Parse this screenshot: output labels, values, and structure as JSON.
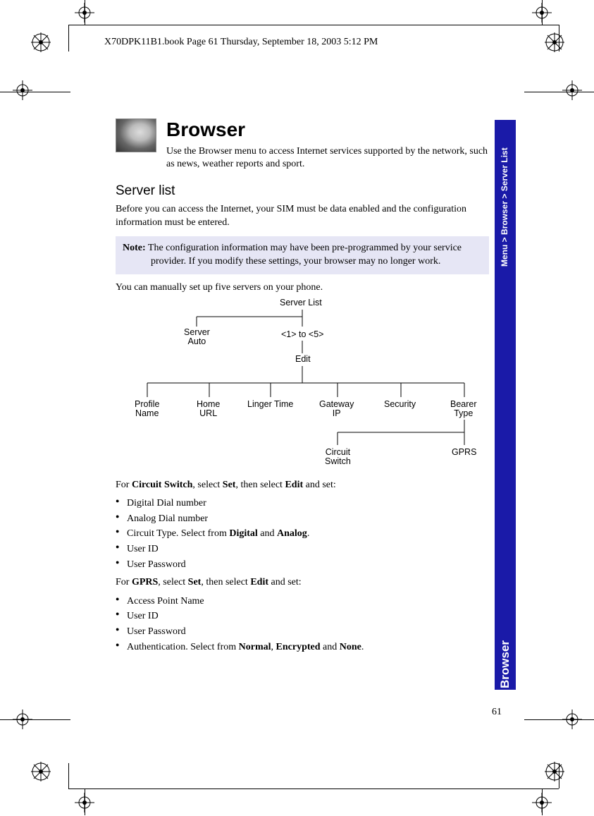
{
  "header": {
    "line": "X70DPK11B1.book  Page 61  Thursday, September 18, 2003  5:12 PM"
  },
  "title": "Browser",
  "intro": "Use the Browser menu to access Internet services supported by the network, such as news, weather reports and sport.",
  "section1": {
    "heading": "Server list",
    "p1": "Before you can access the Internet, your SIM must be data enabled and the configuration information must be entered.",
    "note_prefix": "Note:",
    "note_body": " The configuration information may have been pre-programmed by your service provider. If you modify these settings, your browser may no longer work.",
    "p2": "You can manually set up five servers on your phone."
  },
  "diagram": {
    "root": "Server List",
    "left_child": "Server\nAuto",
    "right_child": "<1> to <5>",
    "edit": "Edit",
    "leaves": [
      "Profile\nName",
      "Home\nURL",
      "Linger Time",
      "Gateway\nIP",
      "Security",
      "Bearer\nType"
    ],
    "sub": [
      "Circuit\nSwitch",
      "GPRS"
    ]
  },
  "cs_intro_pre": "For ",
  "cs_intro_b1": "Circuit Switch",
  "cs_intro_mid1": ", select ",
  "cs_intro_b2": "Set",
  "cs_intro_mid2": ", then select ",
  "cs_intro_b3": "Edit",
  "cs_intro_post": " and set:",
  "cs_bullets": [
    "Digital Dial number",
    "Analog Dial number",
    {
      "pre": "Circuit Type. Select from ",
      "b1": "Digital",
      "mid": " and ",
      "b2": "Analog",
      "post": "."
    },
    "User ID",
    "User Password"
  ],
  "gprs_intro_pre": "For ",
  "gprs_intro_b1": "GPRS",
  "gprs_intro_mid1": ", select ",
  "gprs_intro_b2": "Set",
  "gprs_intro_mid2": ", then select ",
  "gprs_intro_b3": "Edit",
  "gprs_intro_post": " and set:",
  "gprs_bullets": [
    "Access Point Name",
    "User ID",
    "User Password",
    {
      "pre": "Authentication. Select from ",
      "b1": "Normal",
      "mid1": ", ",
      "b2": "Encrypted",
      "mid2": " and ",
      "b3": "None",
      "post": "."
    }
  ],
  "side": {
    "breadcrumb": "Menu > Browser > Server List",
    "section": "Browser"
  },
  "page_number": "61"
}
